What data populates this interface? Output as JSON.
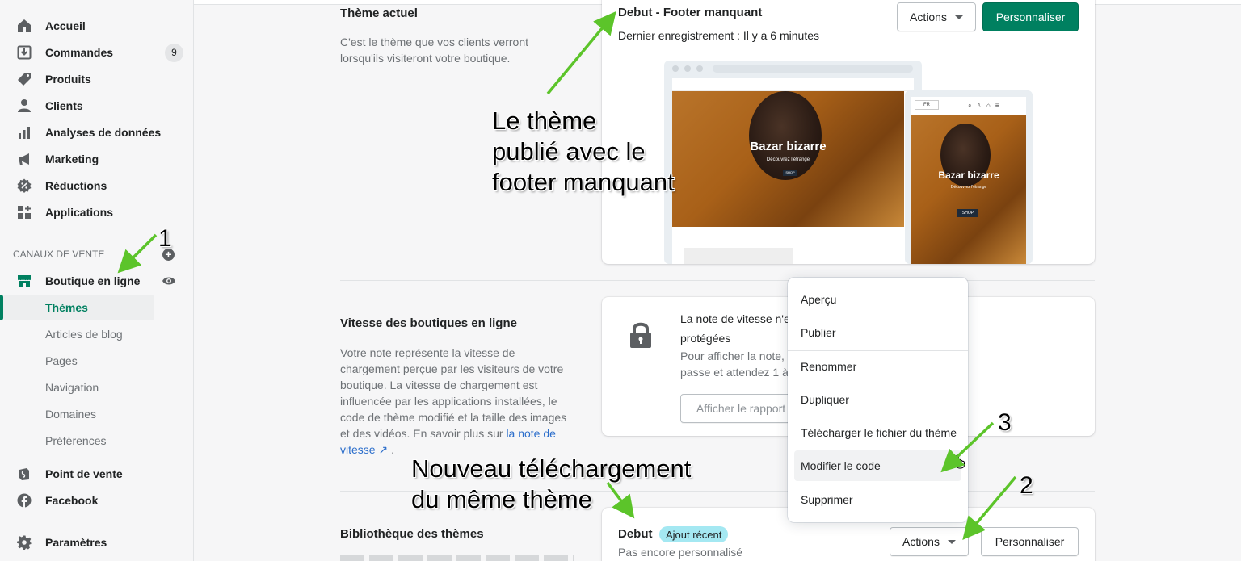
{
  "sidebar": {
    "items": [
      {
        "label": "Accueil",
        "icon": "home-icon"
      },
      {
        "label": "Commandes",
        "icon": "orders-icon",
        "badge": "9"
      },
      {
        "label": "Produits",
        "icon": "tag-icon"
      },
      {
        "label": "Clients",
        "icon": "person-icon"
      },
      {
        "label": "Analyses de données",
        "icon": "bar-chart-icon"
      },
      {
        "label": "Marketing",
        "icon": "megaphone-icon"
      },
      {
        "label": "Réductions",
        "icon": "discount-icon"
      },
      {
        "label": "Applications",
        "icon": "apps-icon"
      }
    ],
    "section_title": "CANAUX DE VENTE",
    "channel": {
      "label": "Boutique en ligne",
      "icon": "store-icon"
    },
    "sub_items": [
      {
        "label": "Thèmes",
        "active": true
      },
      {
        "label": "Articles de blog"
      },
      {
        "label": "Pages"
      },
      {
        "label": "Navigation"
      },
      {
        "label": "Domaines"
      },
      {
        "label": "Préférences"
      }
    ],
    "other_channels": [
      {
        "label": "Point de vente",
        "icon": "pos-icon"
      },
      {
        "label": "Facebook",
        "icon": "facebook-icon"
      }
    ],
    "settings": {
      "label": "Paramètres",
      "icon": "gear-icon"
    }
  },
  "current_theme": {
    "heading": "Thème actuel",
    "description": "C'est le thème que vos clients verront lorsqu'ils visiteront votre boutique.",
    "name": "Debut - Footer manquant",
    "last_saved": "Dernier enregistrement : Il y a 6 minutes",
    "actions_label": "Actions",
    "customize_label": "Personnaliser",
    "preview": {
      "hero_title": "Bazar bizarre",
      "hero_sub": "Découvrez l'étrange",
      "shop_label": "SHOP",
      "lang": "FR"
    }
  },
  "speed": {
    "heading": "Vitesse des boutiques en ligne",
    "description": "Votre note représente la vitesse de chargement perçue par les visiteurs de votre boutique. La vitesse de chargement est influencée par les applications installées, le code de thème modifié et la taille des images et des vidéos. En savoir plus sur",
    "link": "la note de vitesse",
    "card_line1": "La note de vitesse n'e",
    "card_line2": "protégées",
    "card_line3": "Pour afficher la note, c",
    "card_line4": "passe et attendez 1 à",
    "report_button": "Afficher le rapport"
  },
  "library": {
    "heading": "Bibliothèque des thèmes",
    "theme_name": "Debut",
    "badge": "Ajout récent",
    "status": "Pas encore personnalisé",
    "actions_label": "Actions",
    "customize_label": "Personnaliser"
  },
  "actions_menu": {
    "items": [
      "Aperçu",
      "Publier",
      "Renommer",
      "Dupliquer",
      "Télécharger le fichier du thème",
      "Modifier le code",
      "Supprimer"
    ]
  },
  "annotations": {
    "published_line1": "Le thème",
    "published_line2": "publié avec le",
    "published_line3": "footer manquant",
    "new_line1": "Nouveau téléchargement",
    "new_line2": "du même thème",
    "n1": "1",
    "n2": "2",
    "n3": "3"
  },
  "colors": {
    "accent": "#008060",
    "annotation_arrow": "#5cc42a"
  }
}
